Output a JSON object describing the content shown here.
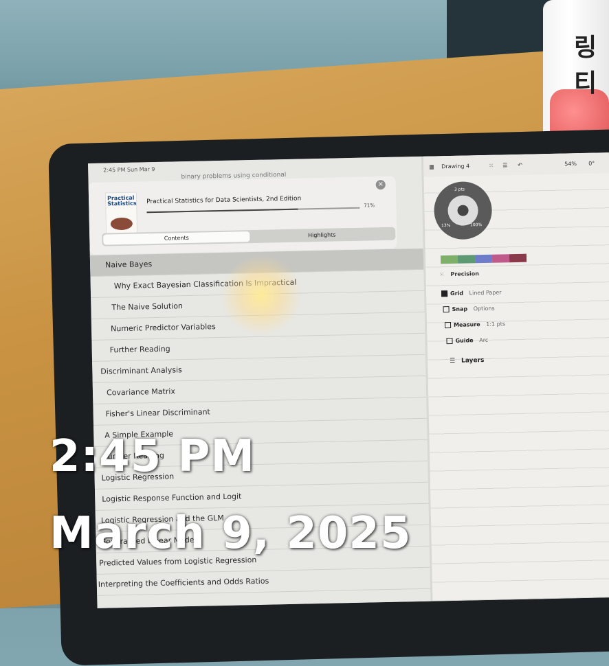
{
  "overlay": {
    "time": "2:45 PM",
    "date": "March 9, 2025"
  },
  "bottle": {
    "label": "링티"
  },
  "ipad": {
    "status_bar": "2:45 PM  Sun Mar 9",
    "reader": {
      "top_text": "binary problems using conditional",
      "book_title": "Practical Statistics for Data Scientists, 2nd Edition",
      "cover_title": "Practical Statistics",
      "progress_percent": 71,
      "progress_label": "71%",
      "close_label": "×",
      "tabs": {
        "contents": "Contents",
        "highlights": "Highlights"
      },
      "toc": [
        {
          "label": "Naive Bayes",
          "active": true
        },
        {
          "label": "Why Exact Bayesian Classification Is Impractical",
          "active": false
        },
        {
          "label": "The Naive Solution",
          "active": false
        },
        {
          "label": "Numeric Predictor Variables",
          "active": false
        },
        {
          "label": "Further Reading",
          "active": false
        },
        {
          "label": "Discriminant Analysis",
          "active": false
        },
        {
          "label": "Covariance Matrix",
          "active": false
        },
        {
          "label": "Fisher's Linear Discriminant",
          "active": false
        },
        {
          "label": "A Simple Example",
          "active": false
        },
        {
          "label": "Further Reading",
          "active": false
        },
        {
          "label": "Logistic Regression",
          "active": false
        },
        {
          "label": "Logistic Response Function and Logit",
          "active": false
        },
        {
          "label": "Logistic Regression and the GLM",
          "active": false
        },
        {
          "label": "Generalized Linear Models",
          "active": false
        },
        {
          "label": "Predicted Values from Logistic Regression",
          "active": false
        },
        {
          "label": "Interpreting the Coefficients and Odds Ratios",
          "active": false
        }
      ]
    },
    "drawing": {
      "title": "Drawing 4",
      "zoom": "54%",
      "angle": "0°",
      "brush_size": "3 pts",
      "opacity": "13%",
      "fill": "100%",
      "swatch_colors": [
        "#7fb06a",
        "#5d9a74",
        "#6e7cc9",
        "#c05a8a",
        "#8a3a4a"
      ],
      "precision_label": "Precision",
      "grid": {
        "label": "Grid",
        "value": "Lined Paper",
        "checked": true
      },
      "snap": {
        "label": "Snap",
        "value": "Options",
        "checked": false
      },
      "measure": {
        "label": "Measure",
        "value": "1:1 pts",
        "checked": false
      },
      "guide": {
        "label": "Guide",
        "value": "Arc",
        "checked": false
      },
      "layers_label": "Layers"
    }
  }
}
